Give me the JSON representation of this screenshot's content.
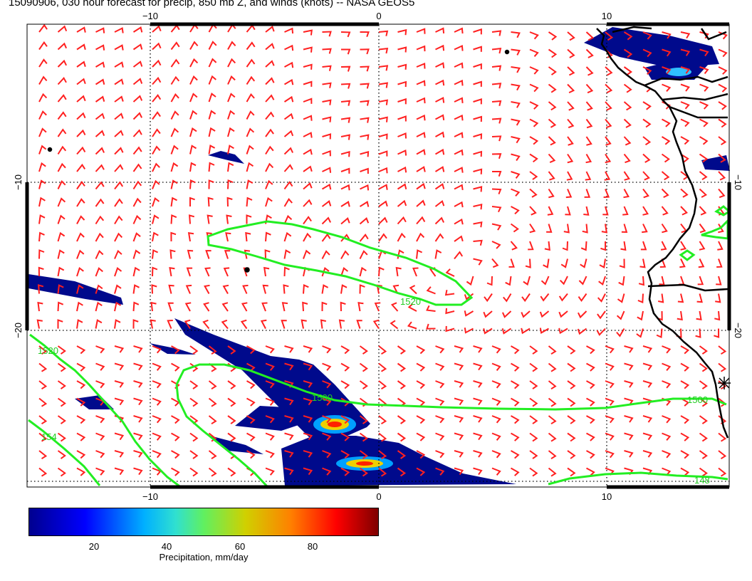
{
  "title": "15090906, 030 hour forecast for precip, 850 mb Z, and winds (knots) -- NASA GEOS5",
  "map": {
    "lon_range": [
      -15.5,
      15.2
    ],
    "lat_range": [
      -26.5,
      -1.8
    ],
    "lon_ticks": [
      "−10",
      "0",
      "10"
    ],
    "lat_ticks": [
      "−10",
      "−20"
    ],
    "contour_labels": [
      "1520",
      "1500",
      "1520",
      "1500",
      "154",
      "148"
    ],
    "contour_levels": [
      1480,
      1500,
      1520,
      1540
    ],
    "contour_color": "#22ee22",
    "barb_color": "#ff2020",
    "coast_color": "#000000",
    "grid_style": "dotted"
  },
  "colorbar": {
    "ticks": [
      "20",
      "40",
      "60",
      "80"
    ],
    "tick_values": [
      20,
      40,
      60,
      80
    ],
    "range": [
      2,
      97
    ],
    "label": "Precipitation, mm/day",
    "colors": [
      "#00008f",
      "#0000ff",
      "#00b0ff",
      "#30e0d0",
      "#60f060",
      "#d0d000",
      "#ff8000",
      "#ff0000",
      "#7f0000"
    ]
  }
}
